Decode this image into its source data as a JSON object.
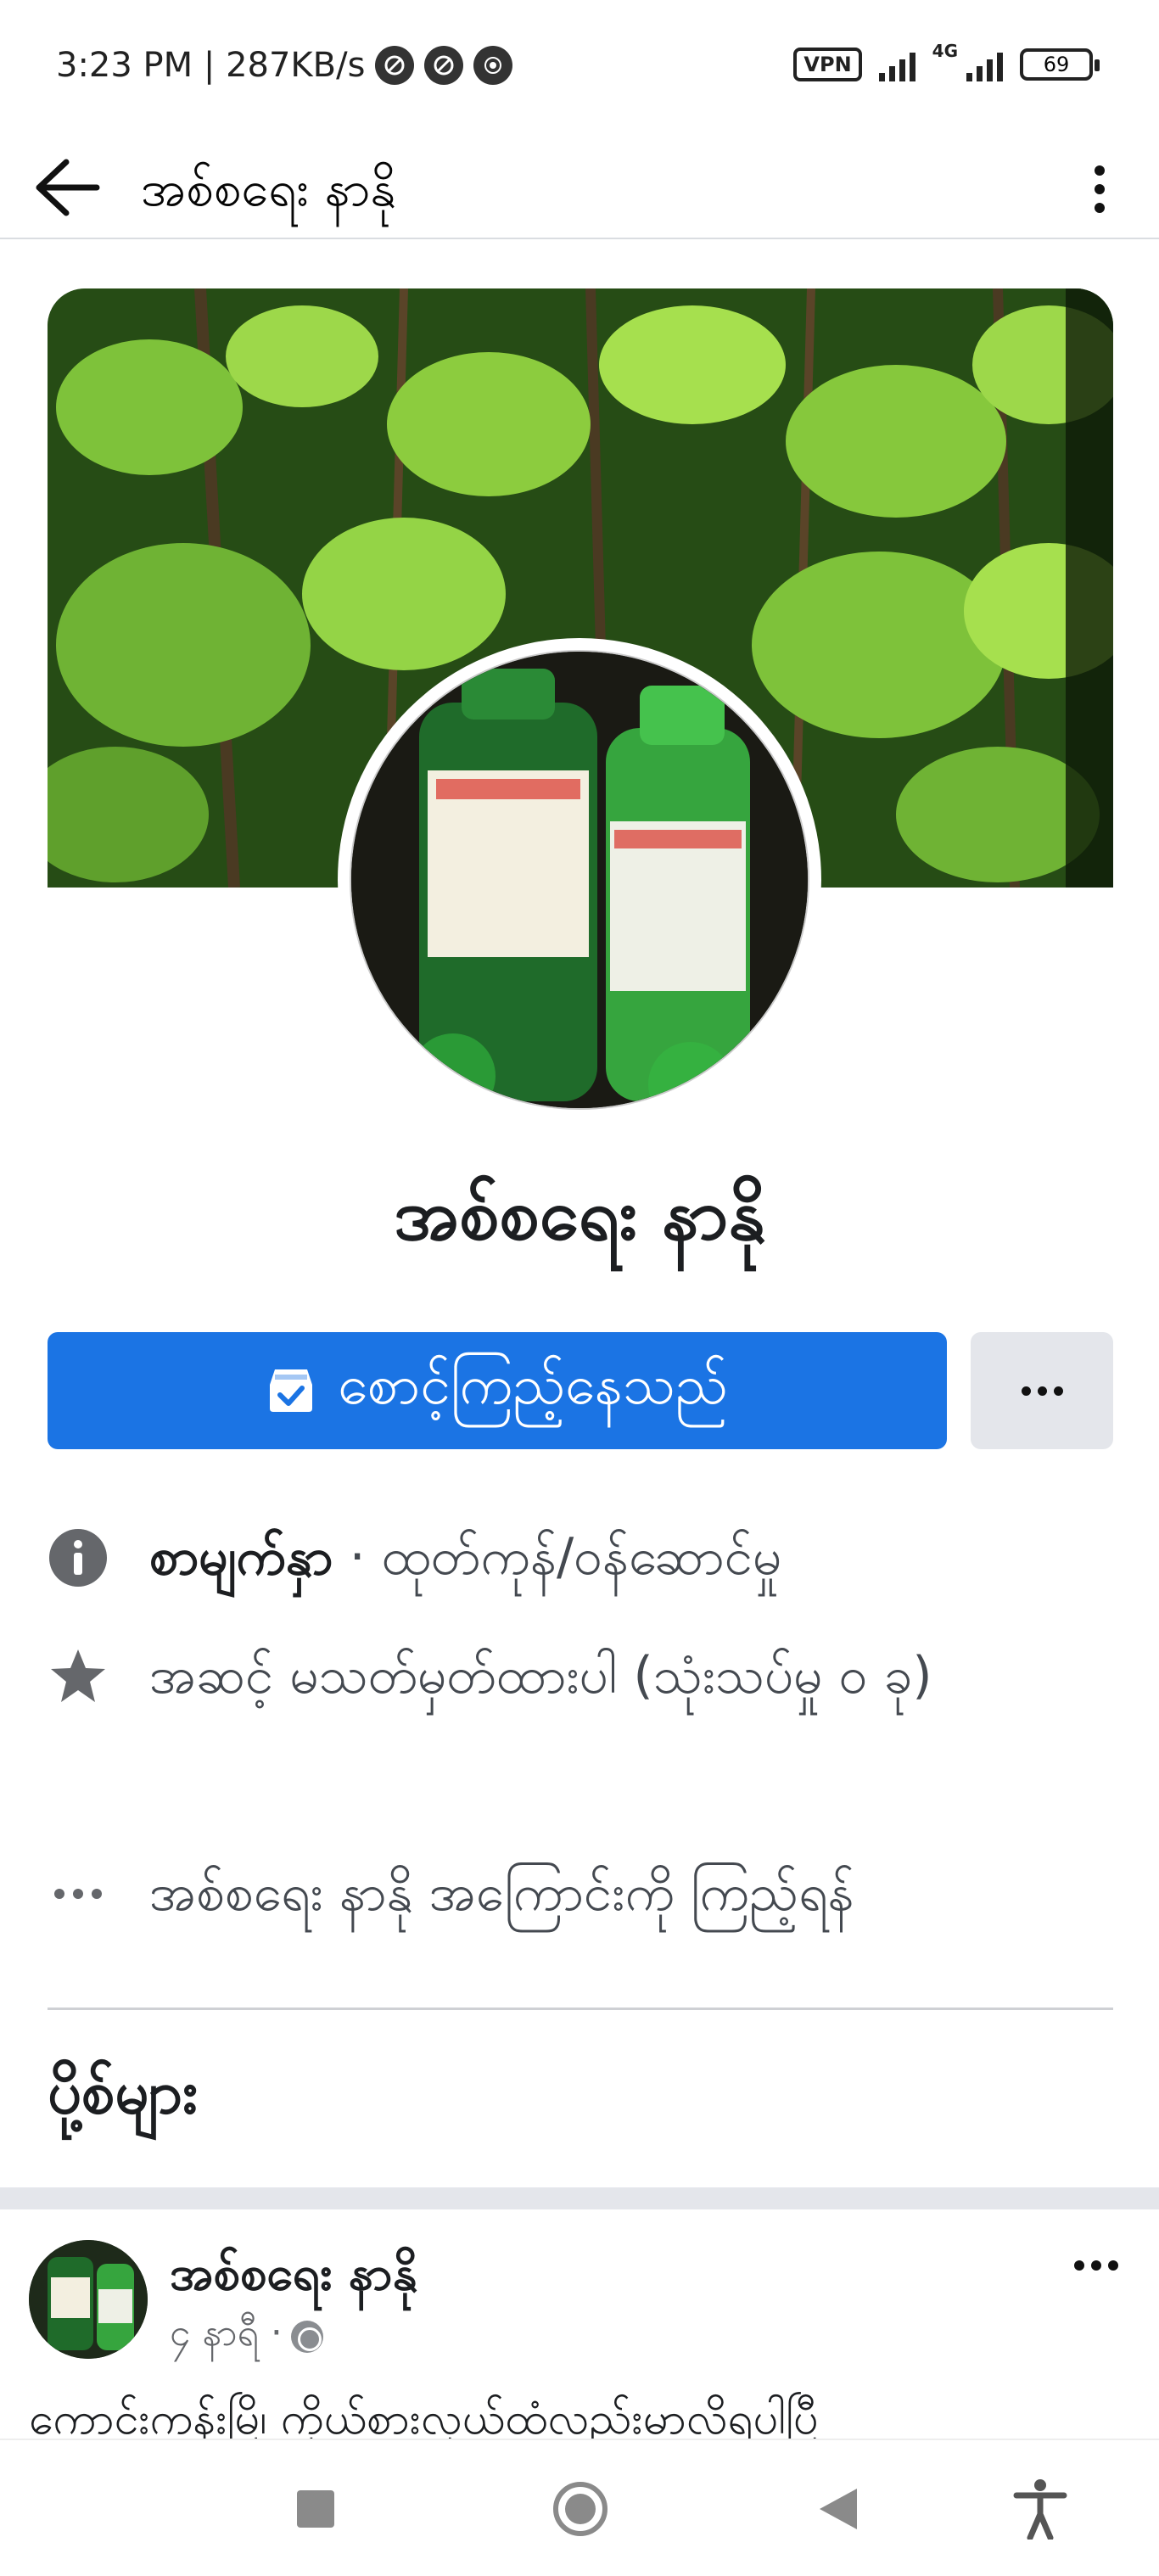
{
  "status_bar": {
    "time_and_speed": "3:23 PM | 287KB/s",
    "vpn": "VPN",
    "network": "4G",
    "battery": "69"
  },
  "app_bar": {
    "title": "အစ်စရေး နာနို"
  },
  "profile": {
    "name": "အစ်စရေး နာနို",
    "following_label": "စောင့်ကြည့်နေသည်"
  },
  "info": {
    "category_bold": "စာမျက်နှာ",
    "category_rest": " · ထုတ်ကုန်/ဝန်ဆောင်မှု",
    "rating": "အဆင့် မသတ်မှတ်ထားပါ (သုံးသပ်မှု ၀ ခု)",
    "about": "အစ်စရေး နာနို အကြောင်းကို ကြည့်ရန်"
  },
  "posts_heading": "ပို့စ်များ",
  "post": {
    "author": "အစ်စရေး နာနို",
    "time": "၄ နာရီ ·",
    "text": "ကောင်းကန်းမြိ၊ ကိုယ်စားလှယ်ထံလည်းမာလိရပါပြီ"
  },
  "icons": {
    "back": "arrow-left-icon",
    "more": "more-vertical-icon",
    "info": "info-icon",
    "star": "star-icon",
    "ellipsis": "ellipsis-icon",
    "globe": "globe-icon",
    "inbox": "inbox-check-icon"
  },
  "colors": {
    "primary": "#1b74e4",
    "secondary_button": "#e4e6eb",
    "icon_gray": "#65676b"
  }
}
